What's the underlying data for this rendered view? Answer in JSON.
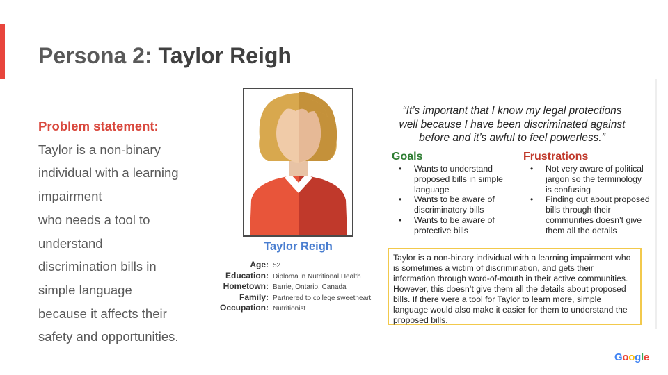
{
  "slide": {
    "title_prefix": "Persona 2: ",
    "title_name": "Taylor Reigh",
    "accent_color": "#e8453c"
  },
  "problem": {
    "label": "Problem statement:",
    "lines": [
      "Taylor is a non-binary",
      "individual with a learning",
      "impairment",
      "who needs a tool to",
      "understand",
      "discrimination bills in",
      "simple language",
      "because it affects their",
      "safety and opportunities."
    ]
  },
  "persona": {
    "name": "Taylor Reigh",
    "avatar_icon": "person-avatar-icon",
    "fields": [
      {
        "label": "Age:",
        "value": "52"
      },
      {
        "label": "Education:",
        "value": "Diploma in Nutritional Health"
      },
      {
        "label": "Hometown:",
        "value": "Barrie, Ontario, Canada"
      },
      {
        "label": "Family:",
        "value": "Partnered to college sweetheart"
      },
      {
        "label": "Occupation:",
        "value": "Nutritionist"
      }
    ]
  },
  "card": {
    "quote_lines": [
      "“It’s important that I know my legal protections",
      "well because I have been discriminated against",
      "before and it’s awful to feel powerless.”"
    ],
    "goals_title": "Goals",
    "goals": [
      "Wants to understand proposed bills in simple language",
      "Wants to be aware of discriminatory bills",
      "Wants to be aware of protective bills"
    ],
    "frustrations_title": "Frustrations",
    "frustrations": [
      "Not very aware of political jargon so the terminology is confusing",
      "Finding out about proposed bills through their communities doesn’t give them all the details"
    ],
    "summary": "Taylor is a non-binary individual with a learning impairment who is sometimes a victim of discrimination, and gets their information through word-of-mouth in their active communities. However, this doesn’t give them all the details about proposed bills. If there were a tool for Taylor to learn more, simple language would also make it easier for them to understand the proposed bills."
  },
  "branding": {
    "logo_letters": [
      "G",
      "o",
      "o",
      "g",
      "l",
      "e"
    ],
    "logo_colors": [
      "#4285F4",
      "#EA4335",
      "#FBBC05",
      "#4285F4",
      "#34A853",
      "#EA4335"
    ]
  }
}
